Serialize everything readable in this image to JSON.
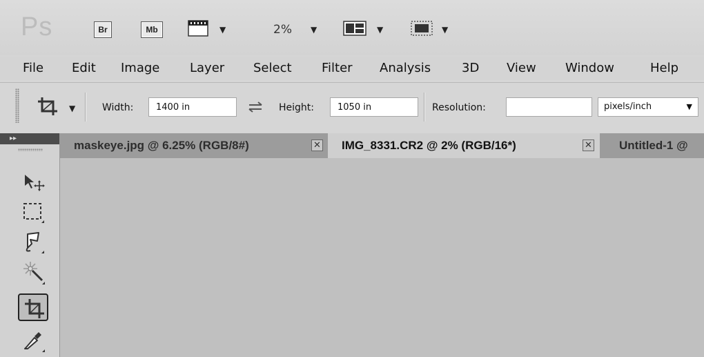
{
  "app": {
    "logo": "Ps",
    "bridge_label": "Br",
    "minibridge_label": "Mb",
    "zoom": "2%",
    "icons": [
      "extras-icon",
      "arrange-documents-icon",
      "screen-mode-icon"
    ]
  },
  "menu": {
    "items": [
      "File",
      "Edit",
      "Image",
      "Layer",
      "Select",
      "Filter",
      "Analysis",
      "3D",
      "View",
      "Window",
      "Help"
    ]
  },
  "options": {
    "width_label": "Width:",
    "width_value": "1400 in",
    "height_label": "Height:",
    "height_value": "1050 in",
    "resolution_label": "Resolution:",
    "resolution_value": "",
    "resolution_unit": "pixels/inch"
  },
  "tabs": [
    {
      "label": "maskeye.jpg @ 6.25% (RGB/8#)",
      "active": false
    },
    {
      "label": "IMG_8331.CR2 @ 2% (RGB/16*)",
      "active": true
    },
    {
      "label": "Untitled-1 @",
      "active": false
    }
  ],
  "tools": {
    "header": "▸▸",
    "items": [
      "move-tool",
      "rectangular-marquee-tool",
      "lasso-tool",
      "magic-wand-tool",
      "crop-tool",
      "eyedropper-tool"
    ],
    "active": "crop-tool"
  },
  "colors": {
    "chrome": "#d6d6d6",
    "canvas": "#c0c0c0",
    "tabstrip": "#8c8c8c",
    "active_tab": "#cfcfcf",
    "tools_header": "#4c4c4c"
  }
}
